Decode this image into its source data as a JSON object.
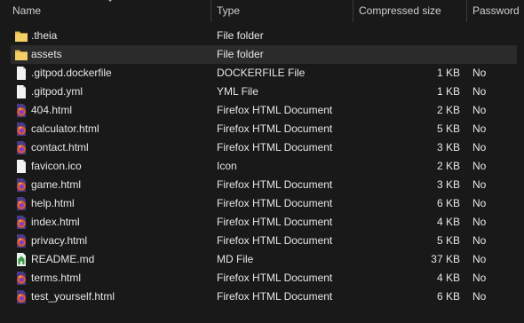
{
  "columns": {
    "name": "Name",
    "type": "Type",
    "compressed_size": "Compressed size",
    "password": "Password"
  },
  "files": [
    {
      "name": ".theia",
      "type": "File folder",
      "size": "",
      "password": "",
      "icon": "folder-icon"
    },
    {
      "name": "assets",
      "type": "File folder",
      "size": "",
      "password": "",
      "icon": "folder-icon",
      "selected": true
    },
    {
      "name": ".gitpod.dockerfile",
      "type": "DOCKERFILE File",
      "size": "1 KB",
      "password": "No",
      "icon": "blank-file-icon"
    },
    {
      "name": ".gitpod.yml",
      "type": "YML File",
      "size": "1 KB",
      "password": "No",
      "icon": "blank-file-icon"
    },
    {
      "name": "404.html",
      "type": "Firefox HTML Document",
      "size": "2 KB",
      "password": "No",
      "icon": "firefox-html-icon"
    },
    {
      "name": "calculator.html",
      "type": "Firefox HTML Document",
      "size": "5 KB",
      "password": "No",
      "icon": "firefox-html-icon"
    },
    {
      "name": "contact.html",
      "type": "Firefox HTML Document",
      "size": "3 KB",
      "password": "No",
      "icon": "firefox-html-icon"
    },
    {
      "name": "favicon.ico",
      "type": "Icon",
      "size": "2 KB",
      "password": "No",
      "icon": "blank-file-icon"
    },
    {
      "name": "game.html",
      "type": "Firefox HTML Document",
      "size": "3 KB",
      "password": "No",
      "icon": "firefox-html-icon"
    },
    {
      "name": "help.html",
      "type": "Firefox HTML Document",
      "size": "6 KB",
      "password": "No",
      "icon": "firefox-html-icon"
    },
    {
      "name": "index.html",
      "type": "Firefox HTML Document",
      "size": "4 KB",
      "password": "No",
      "icon": "firefox-html-icon"
    },
    {
      "name": "privacy.html",
      "type": "Firefox HTML Document",
      "size": "5 KB",
      "password": "No",
      "icon": "firefox-html-icon"
    },
    {
      "name": "README.md",
      "type": "MD File",
      "size": "37 KB",
      "password": "No",
      "icon": "markdown-file-icon"
    },
    {
      "name": "terms.html",
      "type": "Firefox HTML Document",
      "size": "4 KB",
      "password": "No",
      "icon": "firefox-html-icon"
    },
    {
      "name": "test_yourself.html",
      "type": "Firefox HTML Document",
      "size": "6 KB",
      "password": "No",
      "icon": "firefox-html-icon"
    }
  ]
}
